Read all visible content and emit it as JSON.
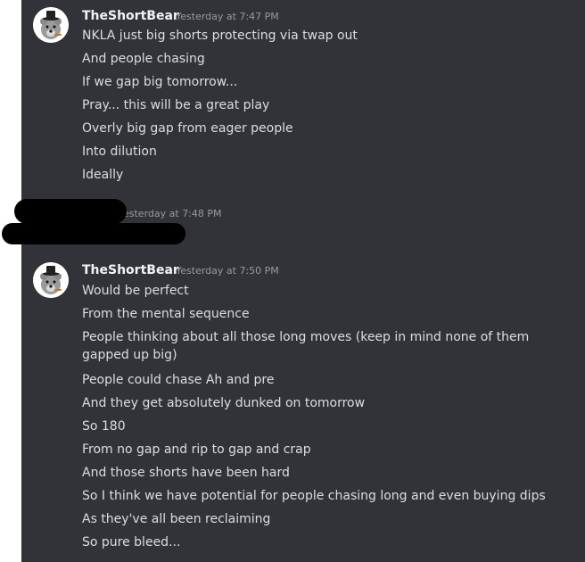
{
  "messages": [
    {
      "author": "TheShortBear",
      "timestamp": "Yesterday at 7:47 PM",
      "avatar": "bear-icon",
      "lines": [
        "NKLA just big shorts protecting via twap out",
        "And people chasing",
        "If we gap big tomorrow...",
        "Pray... this will be a great play",
        "Overly big gap from eager people",
        "Into dilution",
        "Ideally"
      ]
    },
    {
      "author": "",
      "timestamp": "esterday at 7:48 PM",
      "redacted": true,
      "lines": []
    },
    {
      "author": "TheShortBear",
      "timestamp": "Yesterday at 7:50 PM",
      "avatar": "bear-icon",
      "lines": [
        "Would be perfect",
        "From the mental sequence",
        "People thinking about all those long moves (keep in mind none of them gapped up big)",
        "People could chase Ah and pre",
        "And they get absolutely dunked on tomorrow",
        "So 180",
        "From no gap and rip to gap and crap",
        "And those shorts have been hard",
        "So I think we have potential for people chasing long and even buying dips",
        "As they've all been reclaiming",
        "So pure bleed..."
      ]
    }
  ],
  "colors": {
    "background": "#313338",
    "author": "#f2f3f5",
    "text": "#dbdee1",
    "timestamp": "#949ba4"
  }
}
